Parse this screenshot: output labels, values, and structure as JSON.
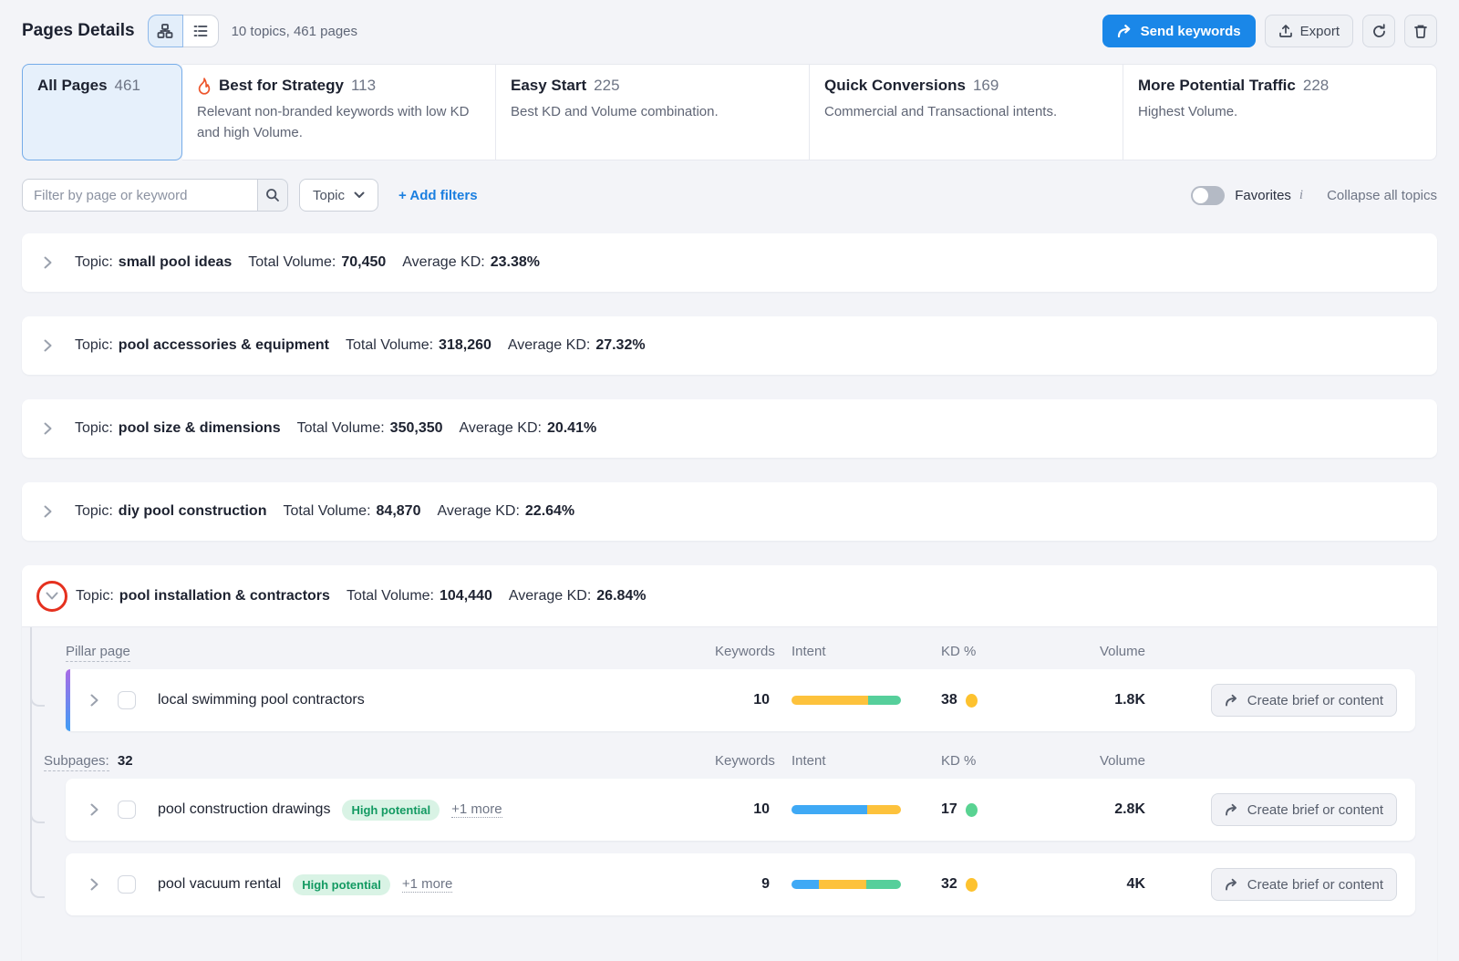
{
  "header": {
    "title": "Pages Details",
    "summary": "10 topics, 461 pages",
    "send_keywords_label": "Send keywords",
    "export_label": "Export"
  },
  "tabs": [
    {
      "label": "All Pages",
      "count": "461",
      "description": "",
      "selected": true
    },
    {
      "label": "Best for Strategy",
      "count": "113",
      "description": "Relevant non-branded keywords with low KD and high Volume.",
      "icon": "flame"
    },
    {
      "label": "Easy Start",
      "count": "225",
      "description": "Best KD and Volume combination."
    },
    {
      "label": "Quick Conversions",
      "count": "169",
      "description": "Commercial and Transactional intents."
    },
    {
      "label": "More Potential Traffic",
      "count": "228",
      "description": "Highest Volume."
    }
  ],
  "filters": {
    "search_placeholder": "Filter by page or keyword",
    "topic_dropdown": "Topic",
    "add_filters": "+ Add filters",
    "favorites_label": "Favorites",
    "favorites_on": false,
    "info_icon": "i",
    "collapse_all": "Collapse all topics"
  },
  "labels": {
    "topic_prefix": "Topic:",
    "total_volume": "Total Volume:",
    "average_kd": "Average KD:"
  },
  "topics": [
    {
      "name": "small pool ideas",
      "total_volume": "70,450",
      "avg_kd": "23.38%"
    },
    {
      "name": "pool accessories & equipment",
      "total_volume": "318,260",
      "avg_kd": "27.32%"
    },
    {
      "name": "pool size & dimensions",
      "total_volume": "350,350",
      "avg_kd": "20.41%"
    },
    {
      "name": "diy pool construction",
      "total_volume": "84,870",
      "avg_kd": "22.64%"
    }
  ],
  "expanded_topic": {
    "name": "pool installation & contractors",
    "total_volume": "104,440",
    "avg_kd": "26.84%",
    "annotation": {
      "shape": "red-circle",
      "color": "#e5311f",
      "target": "expand-chevron"
    },
    "table_headers": {
      "pillar": "Pillar page",
      "keywords": "Keywords",
      "intent": "Intent",
      "kd": "KD %",
      "volume": "Volume"
    },
    "subpages_label": "Subpages:",
    "subpages_count": "32",
    "pillar": {
      "name": "local swimming pool contractors",
      "keywords": "10",
      "intent": [
        {
          "color": "#fdc23c",
          "pct": 70
        },
        {
          "color": "#56cf9b",
          "pct": 30
        }
      ],
      "kd": "38",
      "kd_color": "#fdc22f",
      "volume": "1.8K",
      "action": "Create brief or content"
    },
    "subpages": [
      {
        "name": "pool construction drawings",
        "badge": "High potential",
        "more": "+1 more",
        "keywords": "10",
        "intent": [
          {
            "color": "#3fa9f5",
            "pct": 69
          },
          {
            "color": "#fdc23c",
            "pct": 31
          }
        ],
        "kd": "17",
        "kd_color": "#59d392",
        "volume": "2.8K",
        "action": "Create brief or content"
      },
      {
        "name": "pool vacuum rental",
        "badge": "High potential",
        "more": "+1 more",
        "keywords": "9",
        "intent": [
          {
            "color": "#3fa9f5",
            "pct": 25
          },
          {
            "color": "#fdc23c",
            "pct": 43
          },
          {
            "color": "#56cf9b",
            "pct": 32
          }
        ],
        "kd": "32",
        "kd_color": "#fdc22f",
        "volume": "4K",
        "action": "Create brief or content"
      }
    ]
  },
  "colors": {
    "accent_blue": "#1a87e8",
    "selected_tab_bg": "#e6f0fb",
    "flame_orange": "#ed562d",
    "badge_green_bg": "#d9f3e5",
    "badge_green_text": "#139a62",
    "annotation_red": "#e5311f"
  }
}
